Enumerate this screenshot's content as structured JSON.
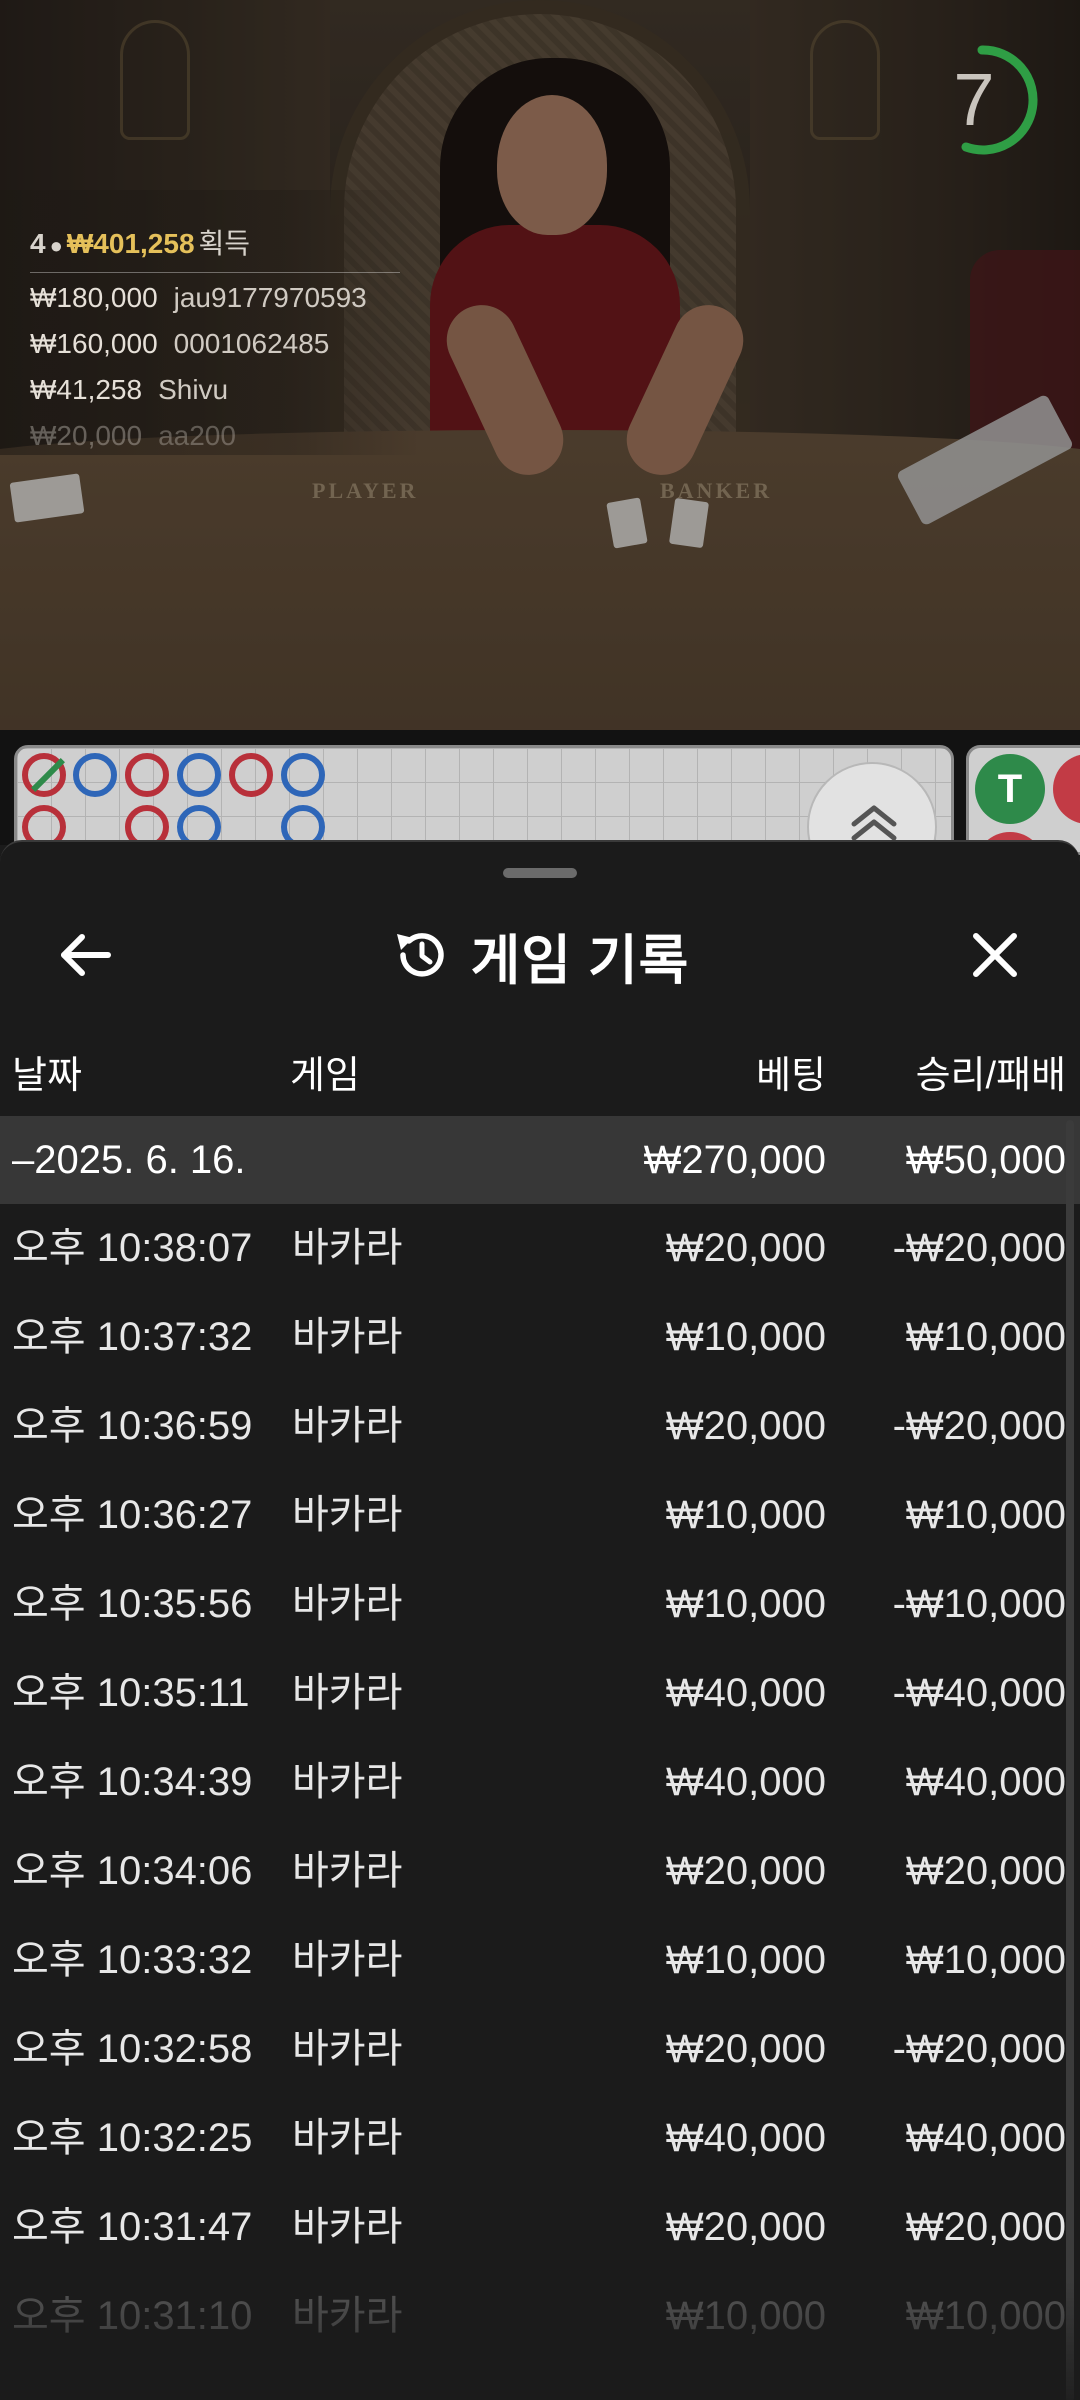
{
  "video": {
    "timer": "7",
    "table_labels": {
      "player": "PLAYER",
      "banker": "BANKER"
    },
    "winners": {
      "count": "4",
      "total": "₩401,258",
      "label": "획득",
      "rows": [
        {
          "amount": "₩180,000",
          "name": "jau9177970593"
        },
        {
          "amount": "₩160,000",
          "name": "0001062485"
        },
        {
          "amount": "₩41,258",
          "name": "Shivu"
        },
        {
          "amount": "₩20,000",
          "name": "aa200"
        }
      ]
    },
    "stats": {
      "tie": "T"
    },
    "colors": {
      "player": "#2e66b8",
      "banker": "#b8303a",
      "tie": "#2e8a4a",
      "gold": "#e5c05a"
    }
  },
  "history": {
    "title": "게임 기록",
    "icons": {
      "back": "arrow-left-icon",
      "history": "history-icon",
      "close": "close-icon"
    },
    "columns": {
      "date": "날짜",
      "game": "게임",
      "bet": "베팅",
      "win": "승리/패배"
    },
    "summary": {
      "date": "–2025. 6. 16.",
      "bet": "₩270,000",
      "win": "₩50,000"
    },
    "rows": [
      {
        "time": "오후 10:38:07",
        "game": "바카라",
        "bet": "₩20,000",
        "win": "-₩20,000"
      },
      {
        "time": "오후 10:37:32",
        "game": "바카라",
        "bet": "₩10,000",
        "win": "₩10,000"
      },
      {
        "time": "오후 10:36:59",
        "game": "바카라",
        "bet": "₩20,000",
        "win": "-₩20,000"
      },
      {
        "time": "오후 10:36:27",
        "game": "바카라",
        "bet": "₩10,000",
        "win": "₩10,000"
      },
      {
        "time": "오후 10:35:56",
        "game": "바카라",
        "bet": "₩10,000",
        "win": "-₩10,000"
      },
      {
        "time": "오후 10:35:11",
        "game": "바카라",
        "bet": "₩40,000",
        "win": "-₩40,000"
      },
      {
        "time": "오후 10:34:39",
        "game": "바카라",
        "bet": "₩40,000",
        "win": "₩40,000"
      },
      {
        "time": "오후 10:34:06",
        "game": "바카라",
        "bet": "₩20,000",
        "win": "₩20,000"
      },
      {
        "time": "오후 10:33:32",
        "game": "바카라",
        "bet": "₩10,000",
        "win": "₩10,000"
      },
      {
        "time": "오후 10:32:58",
        "game": "바카라",
        "bet": "₩20,000",
        "win": "-₩20,000"
      },
      {
        "time": "오후 10:32:25",
        "game": "바카라",
        "bet": "₩40,000",
        "win": "₩40,000"
      },
      {
        "time": "오후 10:31:47",
        "game": "바카라",
        "bet": "₩20,000",
        "win": "₩20,000"
      },
      {
        "time": "오후 10:31:10",
        "game": "바카라",
        "bet": "₩10,000",
        "win": "₩10,000"
      }
    ]
  }
}
